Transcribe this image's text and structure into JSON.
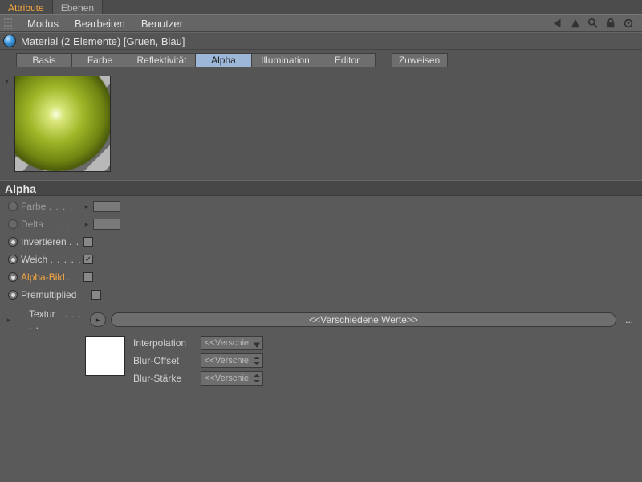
{
  "topTabs": {
    "attribute": "Attribute",
    "ebenen": "Ebenen"
  },
  "menubar": {
    "modus": "Modus",
    "bearbeiten": "Bearbeiten",
    "benutzer": "Benutzer"
  },
  "material": {
    "title": "Material (2 Elemente) [Gruen, Blau]"
  },
  "channelTabs": {
    "basis": "Basis",
    "farbe": "Farbe",
    "reflektivitaet": "Reflektivität",
    "alpha": "Alpha",
    "illumination": "Illumination",
    "editor": "Editor",
    "zuweisen": "Zuweisen"
  },
  "section": {
    "alpha": "Alpha"
  },
  "props": {
    "farbe": "Farbe",
    "delta": "Delta",
    "invertieren": "Invertieren",
    "weich": "Weich",
    "alphaBild": "Alpha-Bild",
    "premultiplied": "Premultiplied"
  },
  "textur": {
    "label": "Textur",
    "fieldValue": "<<Verschiedene Werte>>",
    "interpolation": "Interpolation",
    "blurOffset": "Blur-Offset",
    "blurStaerke": "Blur-Stärke",
    "variousShort": "<<Verschie"
  }
}
